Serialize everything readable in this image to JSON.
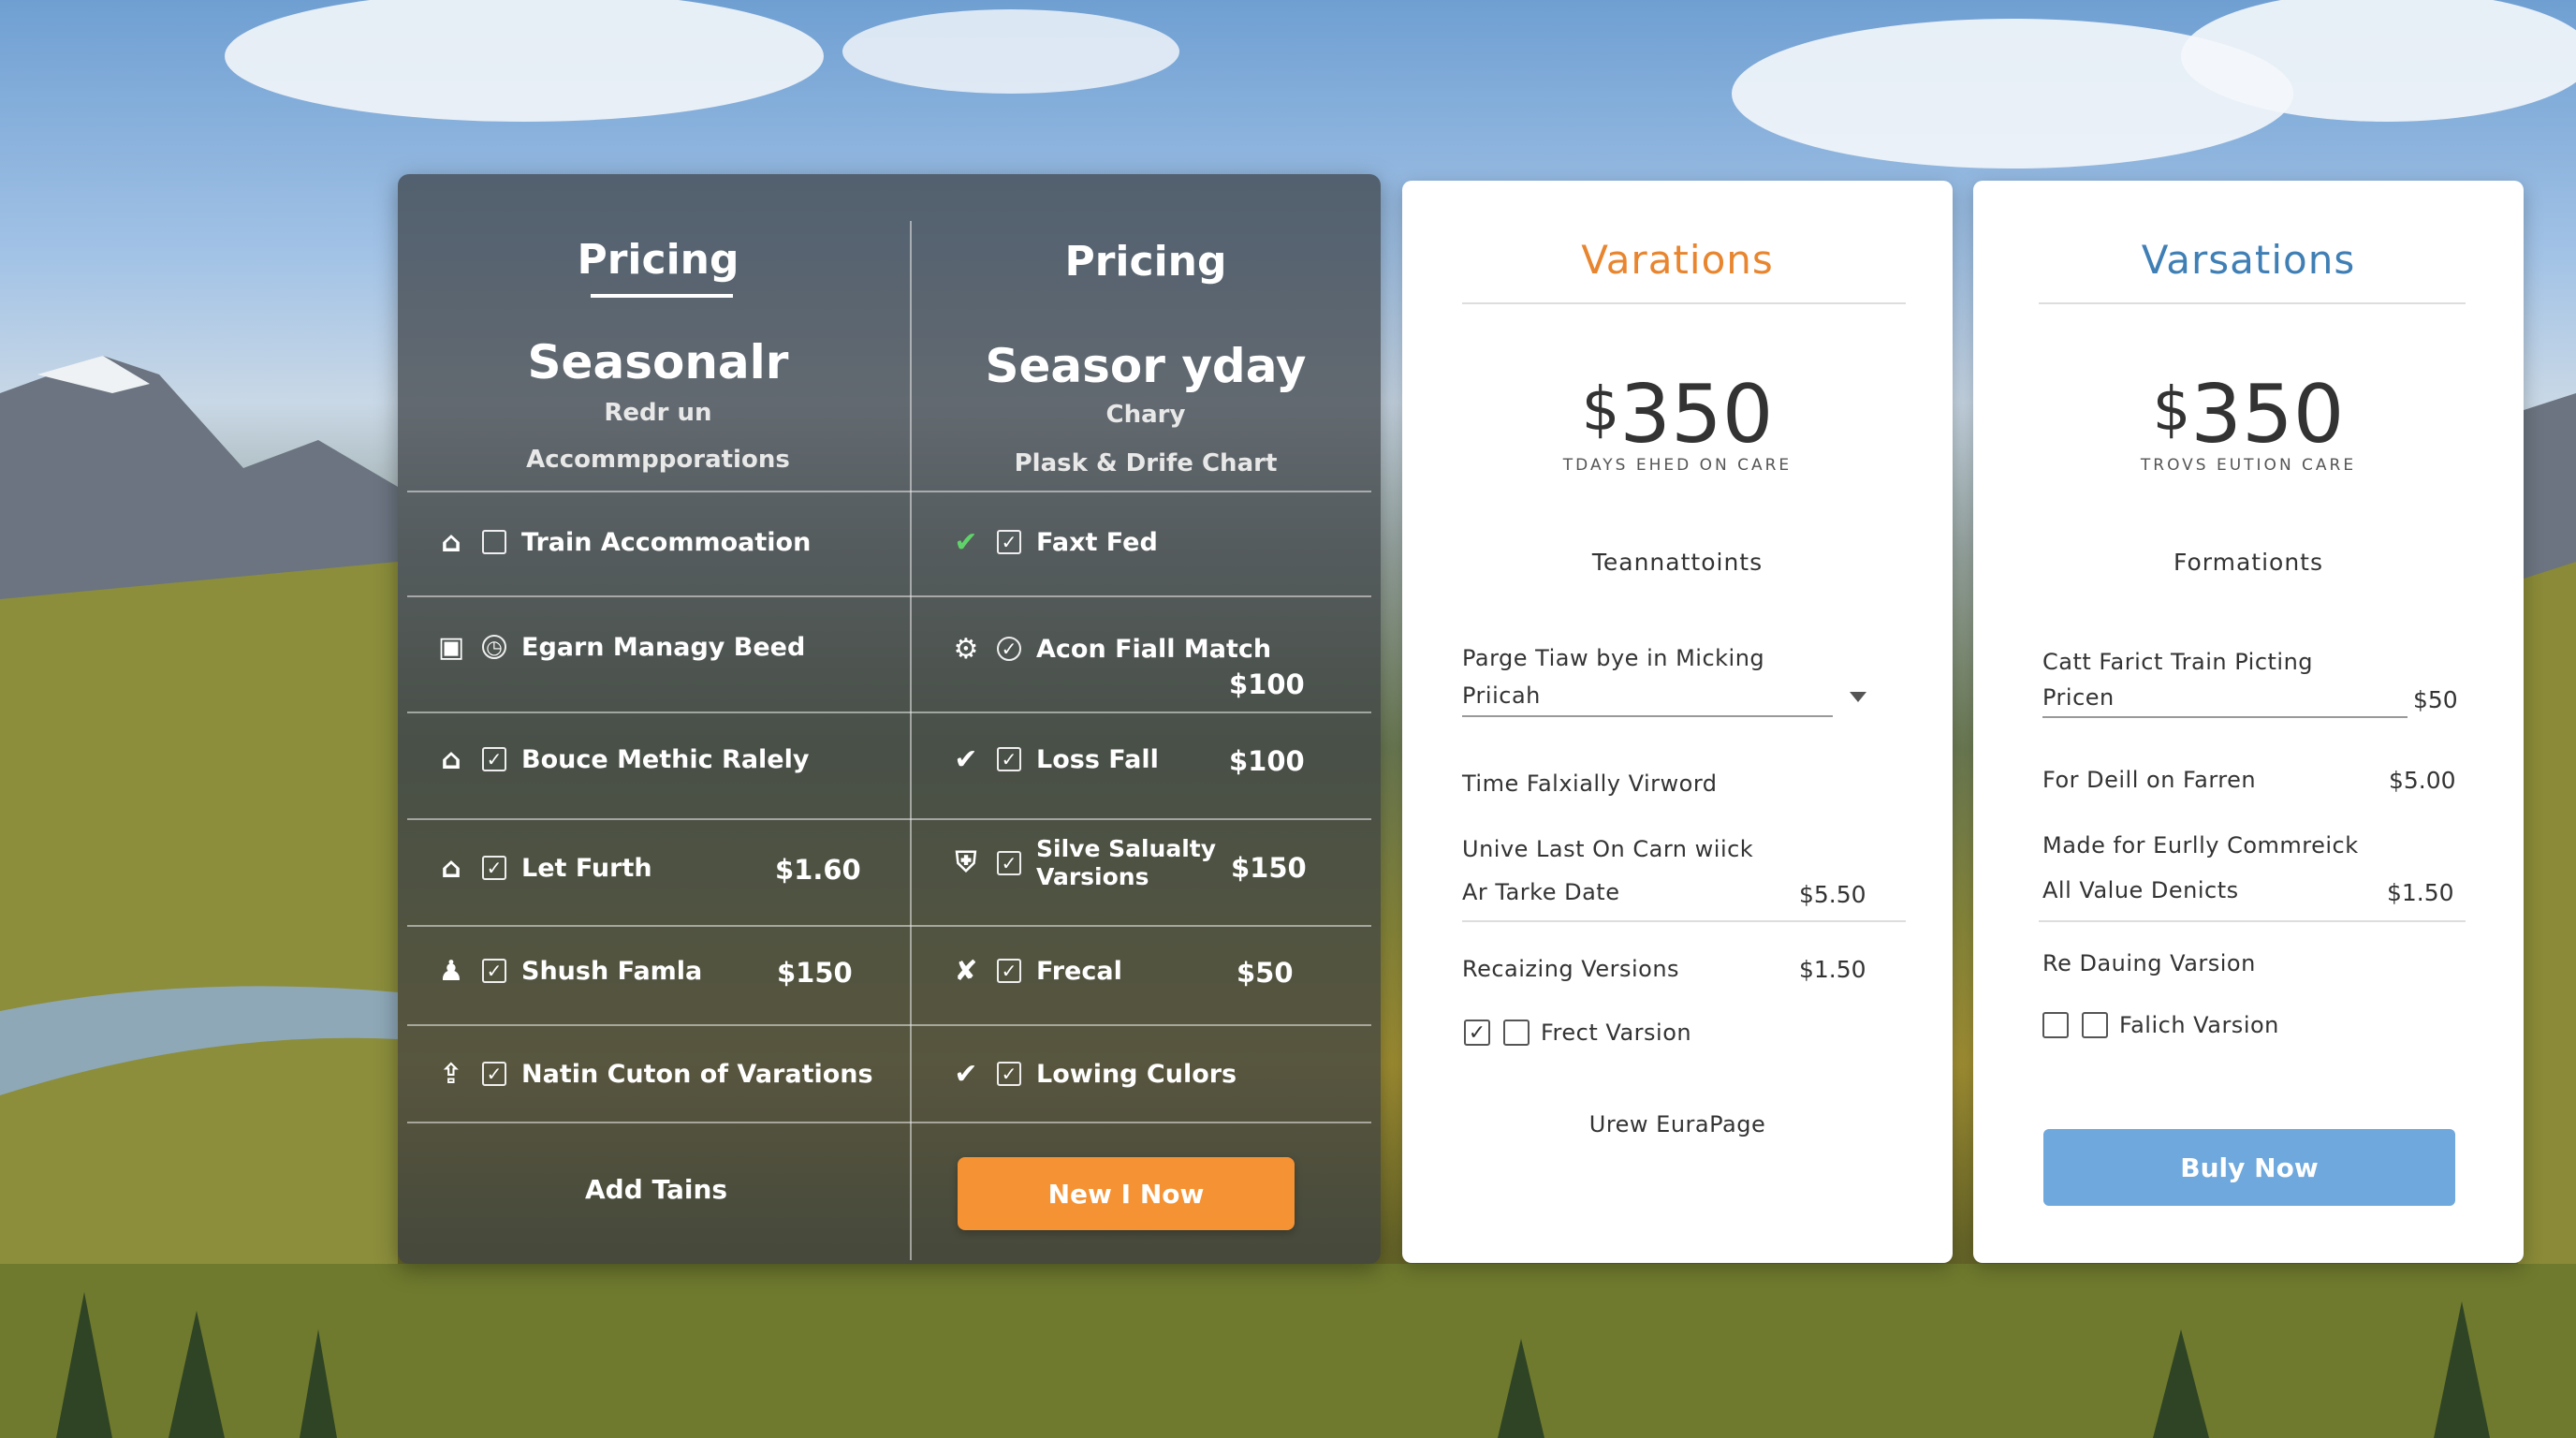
{
  "colors": {
    "accent_orange": "#f59233",
    "accent_blue": "#6ea8dc",
    "title_orange": "#e8852e",
    "title_blue": "#3f7fb5"
  },
  "left_panel": {
    "col1": {
      "pricing": "Pricing",
      "title": "Seasonalr",
      "sub1": "Redr un",
      "sub2": "Accommpporations"
    },
    "col2": {
      "pricing": "Pricing",
      "title": "Seasor yday",
      "sub1": "Chary",
      "sub2": "Plask & Drife Chart"
    },
    "rows_left": [
      {
        "icon": "house-icon",
        "checked": false,
        "label": "Train Accommoation",
        "price": ""
      },
      {
        "icon": "building-icon",
        "checked": false,
        "label": "Egarn Managy Beed",
        "price": ""
      },
      {
        "icon": "house-icon",
        "checked": true,
        "label": "Bouce Methic Ralely",
        "price": ""
      },
      {
        "icon": "home-outline-icon",
        "checked": true,
        "label": "Let Furth",
        "price": "$1.60"
      },
      {
        "icon": "person-icon",
        "checked": true,
        "label": "Shush Famla",
        "price": "$150"
      },
      {
        "icon": "house-arrow-icon",
        "checked": true,
        "label": "Natin Cuton of Varations",
        "price": ""
      }
    ],
    "rows_right": [
      {
        "icon": "check-icon",
        "checked": true,
        "label": "Faxt Fed",
        "price": ""
      },
      {
        "icon": "gear-icon",
        "checked": true,
        "label": "Acon Fiall Match",
        "price": "$100"
      },
      {
        "icon": "check-icon",
        "checked": true,
        "label": "Loss Fall",
        "price": "$100"
      },
      {
        "icon": "shield-icon",
        "checked": true,
        "label": "Silve Salualty",
        "label2": "Varsions",
        "price": "$150"
      },
      {
        "icon": "cross-check-icon",
        "checked": true,
        "label": "Frecal",
        "price": "$50"
      },
      {
        "icon": "check-icon",
        "checked": true,
        "label": "Lowing Culors",
        "price": ""
      }
    ],
    "add_label": "Add Tains",
    "cta": "New I Now"
  },
  "card1": {
    "title": "Varations",
    "currency": "$",
    "price": "350",
    "caption": "TDAYS EHED ON CARE",
    "section": "Teannattoints",
    "select_label": "Parge Tiaw bye in Micking",
    "select_value": "Priicah",
    "line1": "Time Falxially Virword",
    "line2": "Unive Last On Carn wiick",
    "line3": "Ar Tarke Date",
    "amt3": "$5.50",
    "line4": "Recaizing Versions",
    "amt4": "$1.50",
    "check_label": "Frect  Varsion",
    "footer": "Urew EuraPage"
  },
  "card2": {
    "title": "Varsations",
    "currency": "$",
    "price": "350",
    "caption": "TROVS EUTION CARE",
    "section": "Formationts",
    "line1": "Catt Farict Train Picting",
    "line1b": "Pricen",
    "amt1": "$50",
    "line2": "For Deill on Farren",
    "amt2": "$5.00",
    "line3": "Made for Eurlly Commreick",
    "line4": "All Value Denicts",
    "amt4": "$1.50",
    "line5": "Re Dauing Varsion",
    "check_label": "Falich Varsion",
    "cta": "Buly Now"
  }
}
